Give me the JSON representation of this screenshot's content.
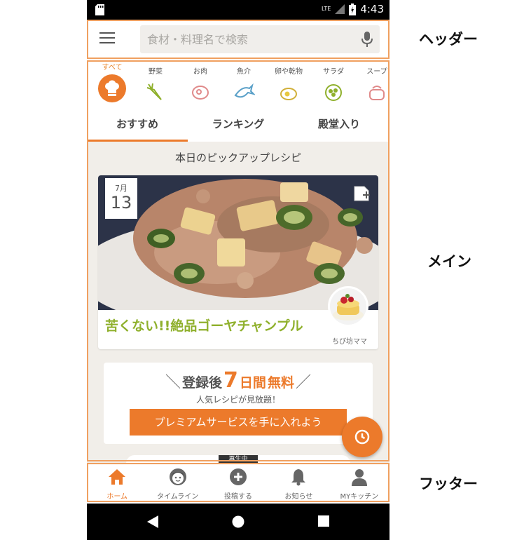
{
  "status_bar": {
    "network": "LTE",
    "time": "4:43"
  },
  "header": {
    "search_placeholder": "食材・料理名で検索"
  },
  "categories": [
    {
      "label": "すべて",
      "icon": "chef-hat-icon"
    },
    {
      "label": "野菜",
      "icon": "carrot-icon"
    },
    {
      "label": "お肉",
      "icon": "meat-icon"
    },
    {
      "label": "魚介",
      "icon": "fish-icon"
    },
    {
      "label": "卵や乾物",
      "icon": "egg-icon"
    },
    {
      "label": "サラダ",
      "icon": "salad-icon"
    },
    {
      "label": "スープ",
      "icon": "pot-icon"
    }
  ],
  "tabs": [
    "おすすめ",
    "ランキング",
    "殿堂入り"
  ],
  "main": {
    "pickup_title": "本日のピックアップレシピ",
    "recipe": {
      "month": "7月",
      "day": "13",
      "title": "苦くない!!絶品ゴーヤチャンプル",
      "author": "ちび坊ママ"
    },
    "premium": {
      "prefix": "登録後",
      "number": "7",
      "unit": "日間",
      "free": "無料",
      "subtitle": "人気レシピが見放題！",
      "cta": "プレミアムサービスを手に入れよう"
    },
    "next_badge": "再生中"
  },
  "footer": [
    {
      "label": "ホーム",
      "icon": "home-icon"
    },
    {
      "label": "タイムライン",
      "icon": "face-icon"
    },
    {
      "label": "投稿する",
      "icon": "plus-circle-icon"
    },
    {
      "label": "お知らせ",
      "icon": "bell-icon"
    },
    {
      "label": "MYキッチン",
      "icon": "person-icon"
    }
  ],
  "annotations": {
    "header": "ヘッダー",
    "main": "メイン",
    "footer": "フッター"
  },
  "colors": {
    "accent": "#ec7a2b",
    "recipe_title": "#8fb02c",
    "frame": "#f0a060"
  }
}
